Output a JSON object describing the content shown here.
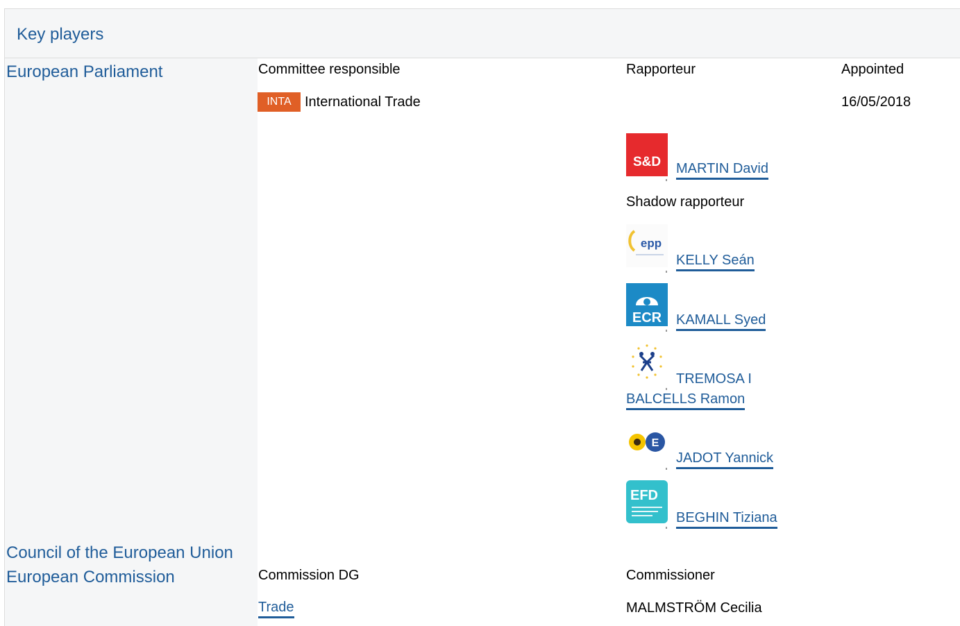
{
  "header": {
    "title": "Key players"
  },
  "institutions": {
    "parliament": "European Parliament",
    "council": "Council of the European Union",
    "commission": "European Commission"
  },
  "parliament": {
    "col_committee": "Committee responsible",
    "col_rapporteur": "Rapporteur",
    "col_appointed": "Appointed",
    "committee_code": "INTA",
    "committee_name": "International Trade",
    "appointed_date": "16/05/2018",
    "rapporteur": {
      "name": "MARTIN David",
      "group_logo": "S&D"
    },
    "shadow_label": "Shadow rapporteur",
    "shadows": [
      {
        "name": "KELLY Seán",
        "group_logo": "epp"
      },
      {
        "name": "KAMALL Syed",
        "group_logo": "ECR"
      },
      {
        "name_line1": "TREMOSA I",
        "name_line2": "BALCELLS Ramon",
        "group_logo": "ALDE"
      },
      {
        "name": "JADOT Yannick",
        "group_logo": "Greens/EFA"
      },
      {
        "name": "BEGHIN Tiziana",
        "group_logo": "EFD"
      }
    ]
  },
  "commission": {
    "col_dg": "Commission DG",
    "col_commissioner": "Commissioner",
    "dg": "Trade",
    "commissioner": "MALMSTRÖM Cecilia"
  },
  "colors": {
    "link": "#1f5c99",
    "badge": "#e05f26",
    "panel": "#f5f6f7"
  }
}
